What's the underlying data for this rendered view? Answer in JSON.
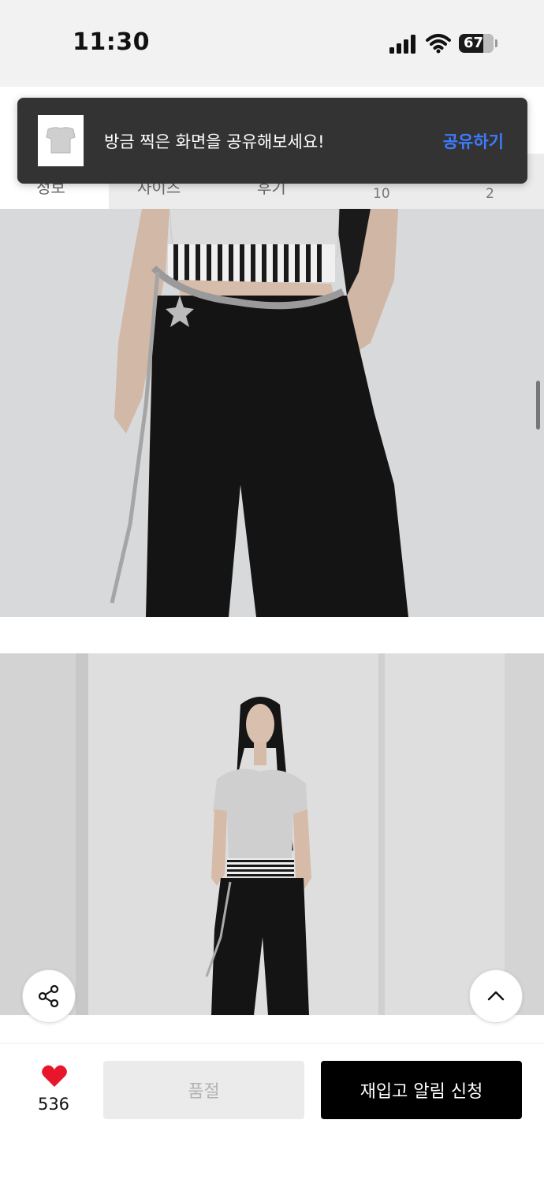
{
  "status_bar": {
    "time": "11:30",
    "battery": "67",
    "icons": [
      "cellular-signal-icon",
      "wifi-icon",
      "battery-icon"
    ]
  },
  "tabs": [
    {
      "label": "정보"
    },
    {
      "label": "사이즈"
    },
    {
      "label": "후기",
      "count": "10"
    },
    {
      "label": "",
      "count": "2"
    }
  ],
  "toast": {
    "message": "방금 찍은 화면을 공유해보세요!",
    "action_label": "공유하기"
  },
  "floating": {
    "share_icon": "share-icon",
    "top_icon": "chevron-up-icon"
  },
  "bottom_bar": {
    "like_count": "536",
    "soldout_label": "품절",
    "restock_label": "재입고 알림 신청",
    "colors": {
      "heart": "#e8162b",
      "restock_bg": "#000000",
      "soldout_bg": "#ebebeb",
      "toast_action": "#3d7bff"
    }
  }
}
